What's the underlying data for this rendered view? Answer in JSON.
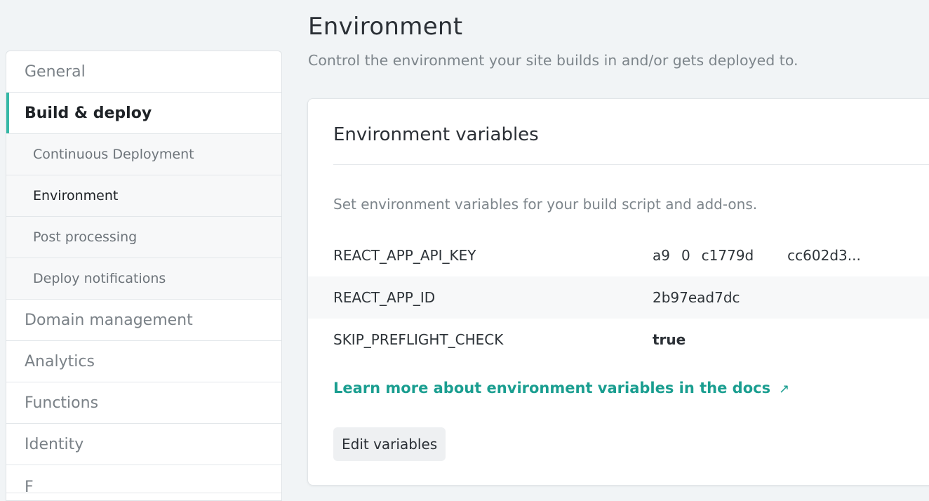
{
  "sidebar": {
    "items": [
      {
        "label": "General"
      },
      {
        "label": "Build & deploy"
      },
      {
        "label": "Continuous Deployment"
      },
      {
        "label": "Environment"
      },
      {
        "label": "Post processing"
      },
      {
        "label": "Deploy notifications"
      },
      {
        "label": "Domain management"
      },
      {
        "label": "Analytics"
      },
      {
        "label": "Functions"
      },
      {
        "label": "Identity"
      }
    ]
  },
  "header": {
    "title": "Environment",
    "subtitle": "Control the environment your site builds in and/or gets deployed to."
  },
  "card": {
    "title": "Environment variables",
    "description": "Set environment variables for your build script and add-ons.",
    "variables": [
      {
        "key": "REACT_APP_API_KEY",
        "value": "a9    0    c1779d            cc602d3..."
      },
      {
        "key": "REACT_APP_ID",
        "value": "2b97ead7dc        "
      },
      {
        "key": "SKIP_PREFLIGHT_CHECK",
        "value": "true"
      }
    ],
    "docs_link": "Learn more about environment variables in the docs",
    "edit_button": "Edit variables"
  },
  "colors": {
    "accent": "#35b8a6",
    "link": "#1a9e90",
    "background": "#f1f4f6"
  },
  "icons": {
    "docs_link": "external-link-arrow-icon"
  }
}
